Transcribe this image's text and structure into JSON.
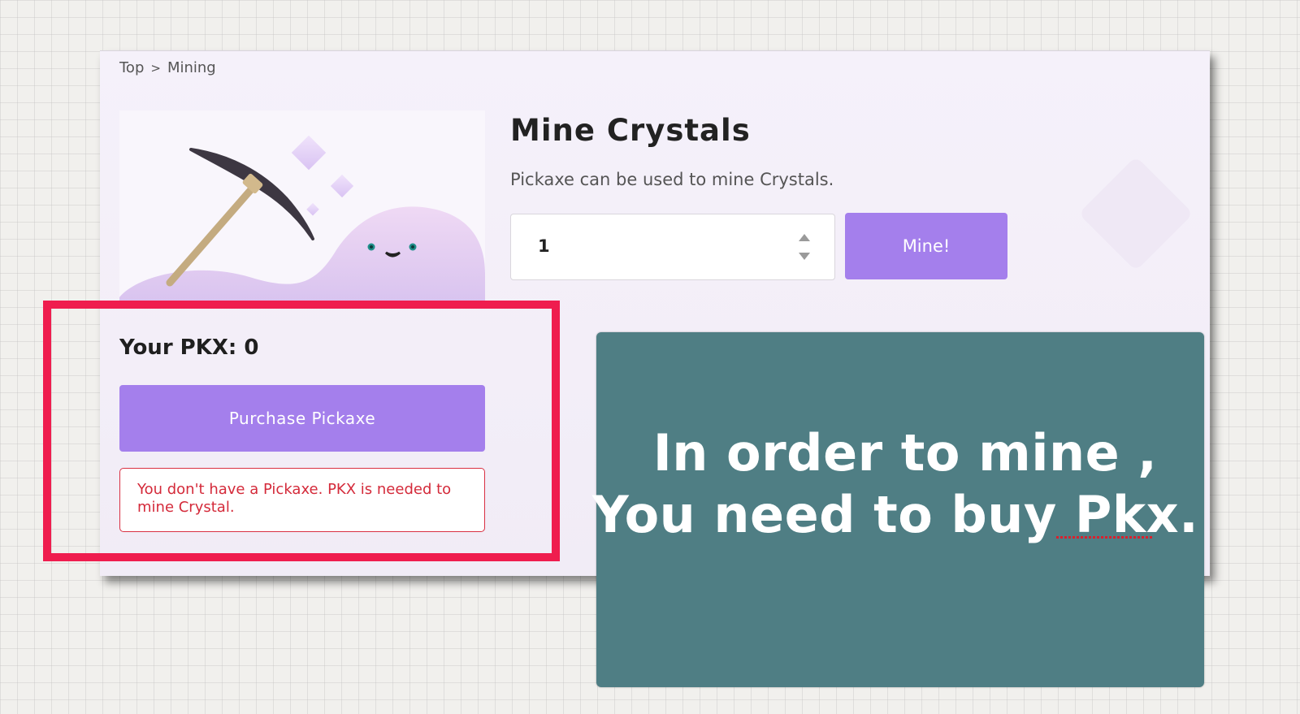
{
  "breadcrumb": {
    "items": [
      "Top",
      "Mining"
    ],
    "separator": ">"
  },
  "mining": {
    "title": "Mine Crystals",
    "description": "Pickaxe can be used to mine Crystals.",
    "quantity_value": "1",
    "mine_button_label": "Mine!"
  },
  "wallet": {
    "balance_text": "Your PKX: 0",
    "purchase_button_label": "Purchase Pickaxe",
    "error_message": "You don't have a Pickaxe. PKX is needed to mine Crystal."
  },
  "annotation": {
    "line1": "In order to mine ,",
    "line2": "You need to buy  Pkx."
  },
  "colors": {
    "accent_purple": "#a47fec",
    "highlight_red": "#ef1d4e",
    "note_teal": "#4f7e84",
    "error_red": "#d42a3a"
  },
  "icons": [
    "pickaxe-icon",
    "crystal-icon",
    "slime-character-icon",
    "stepper-up-icon",
    "stepper-down-icon"
  ]
}
